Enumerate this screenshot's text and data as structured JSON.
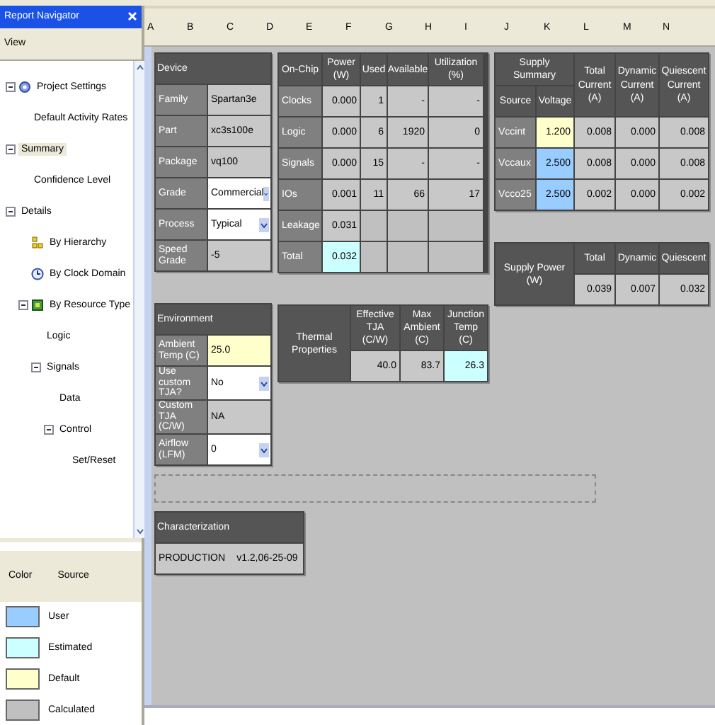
{
  "navigator": {
    "title": "Report Navigator",
    "view_header": "View",
    "tree": [
      {
        "label": "Project Settings",
        "kind": "settings",
        "expanded": true,
        "selected": false,
        "children": [
          {
            "label": "Default Activity Rates",
            "selected": false
          }
        ]
      },
      {
        "label": "Summary",
        "expanded": true,
        "selected": true,
        "children": [
          {
            "label": "Confidence Level",
            "selected": false
          }
        ]
      },
      {
        "label": "Details",
        "expanded": true,
        "selected": false,
        "children": [
          {
            "label": "By Hierarchy",
            "kind": "hierarchy",
            "selected": false
          },
          {
            "label": "By Clock Domain",
            "kind": "clock",
            "selected": false
          },
          {
            "label": "By Resource Type",
            "kind": "resource",
            "expanded": true,
            "selected": false,
            "children": [
              {
                "label": "Logic",
                "selected": false
              },
              {
                "label": "Signals",
                "expanded": true,
                "selected": false,
                "children": [
                  {
                    "label": "Data",
                    "selected": false
                  },
                  {
                    "label": "Control",
                    "expanded": true,
                    "selected": false,
                    "children": [
                      {
                        "label": "Set/Reset",
                        "selected": false
                      }
                    ]
                  }
                ]
              }
            ]
          }
        ]
      }
    ]
  },
  "legend": {
    "columns": [
      "Color",
      "Source"
    ],
    "items": [
      {
        "label": "User",
        "color": "#99ccff"
      },
      {
        "label": "Estimated",
        "color": "#ccffff"
      },
      {
        "label": "Default",
        "color": "#ffffcc"
      },
      {
        "label": "Calculated",
        "color": "#c0c0c0"
      }
    ]
  },
  "sheet": {
    "column_headers": [
      "A",
      "B",
      "C",
      "D",
      "E",
      "F",
      "G",
      "H",
      "I",
      "J",
      "K",
      "L",
      "M",
      "N"
    ],
    "device": {
      "title": "Device",
      "rows": [
        {
          "label": "Family",
          "value": "Spartan3e",
          "dropdown": false
        },
        {
          "label": "Part",
          "value": "xc3s100e",
          "dropdown": false
        },
        {
          "label": "Package",
          "value": "vq100",
          "dropdown": false
        },
        {
          "label": "Grade",
          "value": "Commercial",
          "dropdown": true
        },
        {
          "label": "Process",
          "value": "Typical",
          "dropdown": true
        },
        {
          "label": "Speed Grade",
          "value": "-5",
          "dropdown": false
        }
      ]
    },
    "on_chip": {
      "columns": [
        "On-Chip",
        "Power (W)",
        "Used",
        "Available",
        "Utilization (%)"
      ],
      "rows": [
        {
          "cells": [
            {
              "text": "Clocks"
            },
            {
              "text": "0.000"
            },
            {
              "text": "1"
            },
            {
              "text": "-"
            },
            {
              "text": "-"
            }
          ]
        },
        {
          "cells": [
            {
              "text": "Logic"
            },
            {
              "text": "0.000"
            },
            {
              "text": "6"
            },
            {
              "text": "1920"
            },
            {
              "text": "0"
            }
          ]
        },
        {
          "cells": [
            {
              "text": "Signals"
            },
            {
              "text": "0.000"
            },
            {
              "text": "15"
            },
            {
              "text": "-"
            },
            {
              "text": "-"
            }
          ]
        },
        {
          "cells": [
            {
              "text": "IOs"
            },
            {
              "text": "0.001"
            },
            {
              "text": "11"
            },
            {
              "text": "66"
            },
            {
              "text": "17"
            }
          ]
        },
        {
          "cells": [
            {
              "text": "Leakage"
            },
            {
              "text": "0.031"
            }
          ]
        },
        {
          "cells": [
            {
              "text": "Total"
            },
            {
              "text": "0.032",
              "color": "#ccffff"
            }
          ]
        }
      ]
    },
    "supply_summary": {
      "title": "Supply Summary",
      "columns": [
        "Source",
        "Voltage",
        "Total Current (A)",
        "Dynamic Current (A)",
        "Quiescent Current (A)"
      ],
      "rows": [
        {
          "cells": [
            {
              "text": "Vccint"
            },
            {
              "text": "1.200",
              "color": "#ffffcc"
            },
            {
              "text": "0.008"
            },
            {
              "text": "0.000"
            },
            {
              "text": "0.008"
            }
          ]
        },
        {
          "cells": [
            {
              "text": "Vccaux"
            },
            {
              "text": "2.500",
              "color": "#99ccff"
            },
            {
              "text": "0.008"
            },
            {
              "text": "0.000"
            },
            {
              "text": "0.008"
            }
          ]
        },
        {
          "cells": [
            {
              "text": "Vcco25"
            },
            {
              "text": "2.500",
              "color": "#99ccff"
            },
            {
              "text": "0.002"
            },
            {
              "text": "0.000"
            },
            {
              "text": "0.002"
            }
          ]
        }
      ]
    },
    "supply_power": {
      "label": "Supply Power (W)",
      "columns": [
        "Total",
        "Dynamic",
        "Quiescent"
      ],
      "cells": [
        {
          "text": "0.039"
        },
        {
          "text": "0.007"
        },
        {
          "text": "0.032"
        }
      ]
    },
    "environment": {
      "title": "Environment",
      "rows": [
        {
          "label": "Ambient Temp (C)",
          "value": "25.0",
          "color": "#ffffcc",
          "dropdown": false
        },
        {
          "label": "Use custom TJA?",
          "value": "No",
          "dropdown": true
        },
        {
          "label": "Custom TJA (C/W)",
          "value": "NA",
          "dropdown": false
        },
        {
          "label": "Airflow (LFM)",
          "value": "0",
          "dropdown": true
        }
      ]
    },
    "thermal": {
      "label": "Thermal Properties",
      "columns": [
        "Effective TJA (C/W)",
        "Max Ambient (C)",
        "Junction Temp (C)"
      ],
      "cells": [
        {
          "text": "40.0"
        },
        {
          "text": "83.7"
        },
        {
          "text": "26.3",
          "color": "#ccffff"
        }
      ]
    },
    "characterization": {
      "title": "Characterization",
      "status": "PRODUCTION",
      "version": "v1.2,06-25-09"
    }
  }
}
